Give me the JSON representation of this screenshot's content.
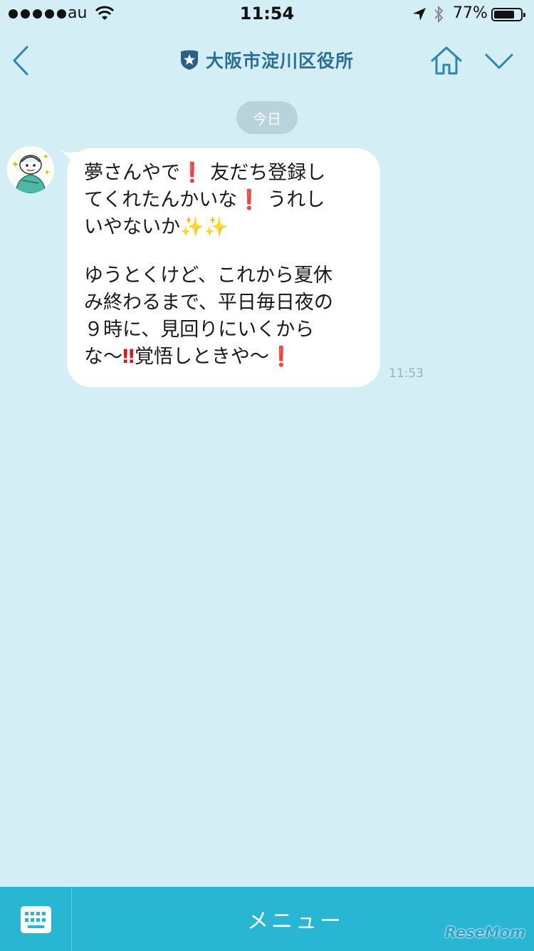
{
  "status_bar": {
    "carrier": "au",
    "time": "11:54",
    "battery_percent": "77%",
    "battery_level": 0.77
  },
  "header": {
    "title": "大阪市淀川区役所",
    "back_icon": "chevron-left-icon",
    "home_icon": "home-icon",
    "menu_icon": "chevron-down-icon",
    "accent_color": "#2a86b3"
  },
  "chat": {
    "date_label": "今日",
    "message": {
      "lines": [
        {
          "text": "夢さんやで",
          "mark": "❗",
          "rest": "友だち登録し"
        },
        {
          "text": "てくれたんかいな",
          "mark": "❗",
          "rest": "うれし"
        },
        {
          "text": "いやないか",
          "sparkles": "✨✨"
        },
        {
          "text": "ゆうとくけど、これから夏休"
        },
        {
          "text": "み終わるまで、平日毎日夜の"
        },
        {
          "text": "９時に、見回りにいくから"
        },
        {
          "text": "な～",
          "mark": "‼",
          "rest": "覚悟しときや～",
          "mark2": "❗"
        }
      ],
      "time": "11:53"
    }
  },
  "bottom_bar": {
    "keyboard_icon": "keyboard-icon",
    "menu_label": "メニュー",
    "color": "#29b6d3"
  },
  "watermark": "ReseMom"
}
